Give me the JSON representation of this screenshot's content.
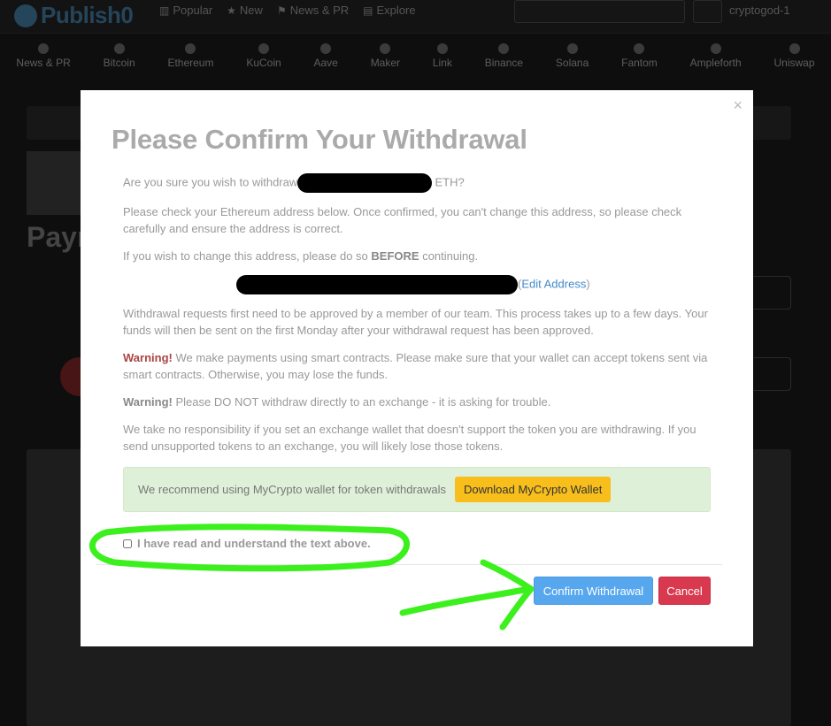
{
  "header": {
    "logo_text": "Publish0",
    "nav": [
      {
        "icon": "chart-icon",
        "label": "Popular"
      },
      {
        "icon": "star-icon",
        "label": "New"
      },
      {
        "icon": "flag-icon",
        "label": "News & PR"
      },
      {
        "icon": "folder-icon",
        "label": "Explore"
      }
    ],
    "username": "cryptogod-1"
  },
  "categories": [
    "News & PR",
    "Bitcoin",
    "Ethereum",
    "KuCoin",
    "Aave",
    "Maker",
    "Link",
    "Binance",
    "Solana",
    "Fantom",
    "Ampleforth",
    "Uniswap"
  ],
  "background": {
    "heading": "Payn"
  },
  "modal": {
    "close": "×",
    "title": "Please Confirm Your Withdrawal",
    "p1_prefix": "Are you sure you wish to withdraw",
    "p1_suffix": "ETH?",
    "p2": "Please check your Ethereum address below. Once confirmed, you can't change this address, so please check carefully and ensure the address is correct.",
    "p3_prefix": "If you wish to change this address, please do so",
    "p3_bold": "BEFORE",
    "p3_suffix": "continuing.",
    "edit_open": "(",
    "edit_link": "Edit Address",
    "edit_close": ")",
    "p4": "Withdrawal requests first need to be approved by a member of our team. This process takes up to a few days. Your funds will then be sent on the first Monday after your withdrawal request has been approved.",
    "warning1_label": "Warning!",
    "warning1_text": "We make payments using smart contracts. Please make sure that your wallet can accept tokens sent via smart contracts. Otherwise, you may lose the funds.",
    "warning2_label": "Warning!",
    "warning2_text": "Please DO NOT withdraw directly to an exchange - it is asking for trouble.",
    "p5": "We take no responsibility if you set an exchange wallet that doesn't support the token you are withdrawing. If you send unsupported tokens to an exchange, you will likely lose those tokens.",
    "recommend_text": "We recommend using MyCrypto wallet for token withdrawals",
    "download_button": "Download MyCrypto Wallet",
    "agree_label": "I have read and understand the text above.",
    "confirm_button": "Confirm Withdrawal",
    "cancel_button": "Cancel"
  },
  "colors": {
    "confirm": "#57a7ef",
    "cancel": "#d9394f",
    "download": "#f7be1c",
    "alert_bg": "#dff0d8",
    "warning": "#a94442",
    "annotation": "#3cf01e"
  }
}
